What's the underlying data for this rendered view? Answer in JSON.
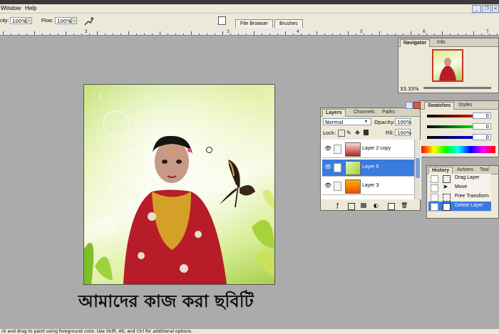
{
  "menubar": {
    "items": [
      "Window",
      "Help"
    ]
  },
  "options_bar": {
    "opacity_label": "city:",
    "opacity_value": "100%",
    "flow_label": "Flow:",
    "flow_value": "100%"
  },
  "well_tabs": [
    "File Browser",
    "Brushes"
  ],
  "ruler": {
    "labels": [
      "2",
      "3",
      "4",
      "5",
      "6",
      "7"
    ]
  },
  "caption": "আমাদের কাজ করা ছবিটি",
  "navigator": {
    "tabs": [
      "Navigator",
      "Info"
    ],
    "zoom": "33.33%"
  },
  "color": {
    "tabs": [
      "Swatches",
      "Styles"
    ],
    "r": "0",
    "g": "0",
    "b": "0"
  },
  "layers": {
    "tabs": [
      "Layers",
      "Channels",
      "Paths"
    ],
    "blend_mode": "Normal",
    "opacity_label": "Opacity:",
    "opacity_value": "100%",
    "lock_label": "Lock:",
    "fill_label": "Fill:",
    "fill_value": "100%",
    "rows": [
      {
        "name": "Layer 2 copy",
        "selected": false
      },
      {
        "name": "Layer 5",
        "selected": true
      },
      {
        "name": "Layer 3",
        "selected": false
      }
    ]
  },
  "history": {
    "tabs": [
      "History",
      "Actions",
      "Tool Pres"
    ],
    "rows": [
      {
        "name": "Drag Layer",
        "selected": false
      },
      {
        "name": "Move",
        "selected": false
      },
      {
        "name": "Free Transform",
        "selected": false
      },
      {
        "name": "Delete Layer",
        "selected": true
      }
    ]
  },
  "status": "ck and drag to paint using foreground color. Use Shift, Alt, and Ctrl for additional options.",
  "colors": {
    "selection": "#3a7be0",
    "ui_bg": "#ece9d8",
    "workspace": "#ababab"
  }
}
